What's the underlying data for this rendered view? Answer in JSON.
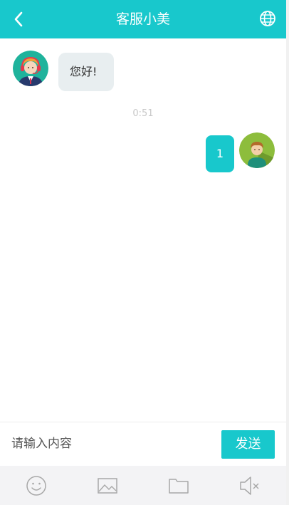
{
  "header": {
    "title": "客服小美"
  },
  "messages": {
    "agent_text": "您好!",
    "timestamp": "0:51",
    "user_text": "1"
  },
  "composer": {
    "placeholder": "请输入内容",
    "send_label": "发送"
  },
  "toolbar": {
    "icons": [
      "smiley-icon",
      "image-icon",
      "folder-icon",
      "mute-icon"
    ]
  },
  "colors": {
    "accent": "#18c8cc",
    "agent_bubble": "#e8eef0",
    "toolbar_bg": "#f3f3f5"
  }
}
